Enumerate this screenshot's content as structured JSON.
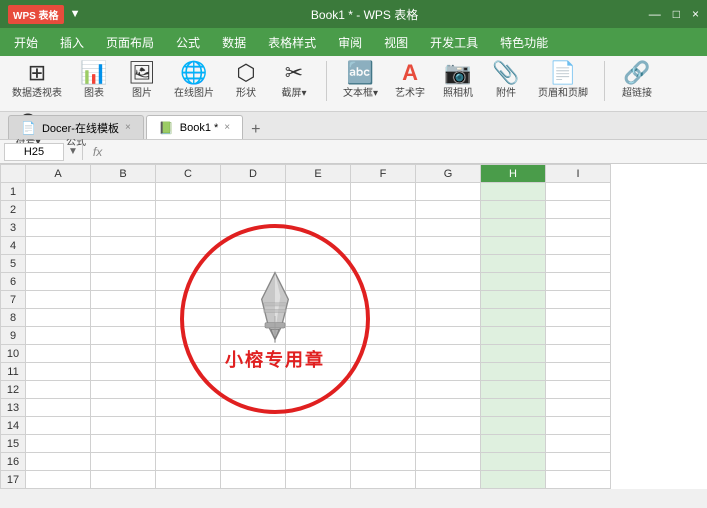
{
  "titleBar": {
    "logo": "WPS 表格",
    "title": "Book1 * - WPS 表格",
    "controls": [
      "—",
      "□",
      "×"
    ]
  },
  "menuBar": {
    "items": [
      "开始",
      "插入",
      "页面布局",
      "公式",
      "数据",
      "表格样式",
      "审阅",
      "视图",
      "开发工具",
      "特色功能"
    ]
  },
  "toolbar": {
    "groups": [
      {
        "icon": "📊",
        "label": "数据透视表"
      },
      {
        "icon": "📈",
        "label": "图表"
      },
      {
        "icon": "🖼",
        "label": "图片"
      },
      {
        "icon": "🖼",
        "label": "在线图片"
      },
      {
        "icon": "⬡",
        "label": "形状"
      },
      {
        "icon": "✂",
        "label": "截屏"
      },
      {
        "icon": "🔤",
        "label": "文本框"
      },
      {
        "icon": "A",
        "label": "艺术字"
      },
      {
        "icon": "📷",
        "label": "照相机"
      },
      {
        "icon": "📎",
        "label": "附件"
      },
      {
        "icon": "📄",
        "label": "页眉和页脚"
      },
      {
        "icon": "🔗",
        "label": "超链接"
      },
      {
        "icon": "Ω",
        "label": "符号"
      },
      {
        "icon": "π",
        "label": "公式"
      }
    ]
  },
  "tabs": [
    {
      "icon": "📄",
      "label": "Docer-在线模板",
      "active": false
    },
    {
      "icon": "📗",
      "label": "Book1 *",
      "active": true
    }
  ],
  "formulaBar": {
    "cellRef": "H25",
    "fx": "fx",
    "value": ""
  },
  "spreadsheet": {
    "columns": [
      "",
      "A",
      "B",
      "C",
      "D",
      "E",
      "F",
      "G",
      "H",
      "I"
    ],
    "rows": 17,
    "selectedCol": "H",
    "selectedCell": "H25"
  },
  "stamp": {
    "text": "小榕专用章"
  }
}
